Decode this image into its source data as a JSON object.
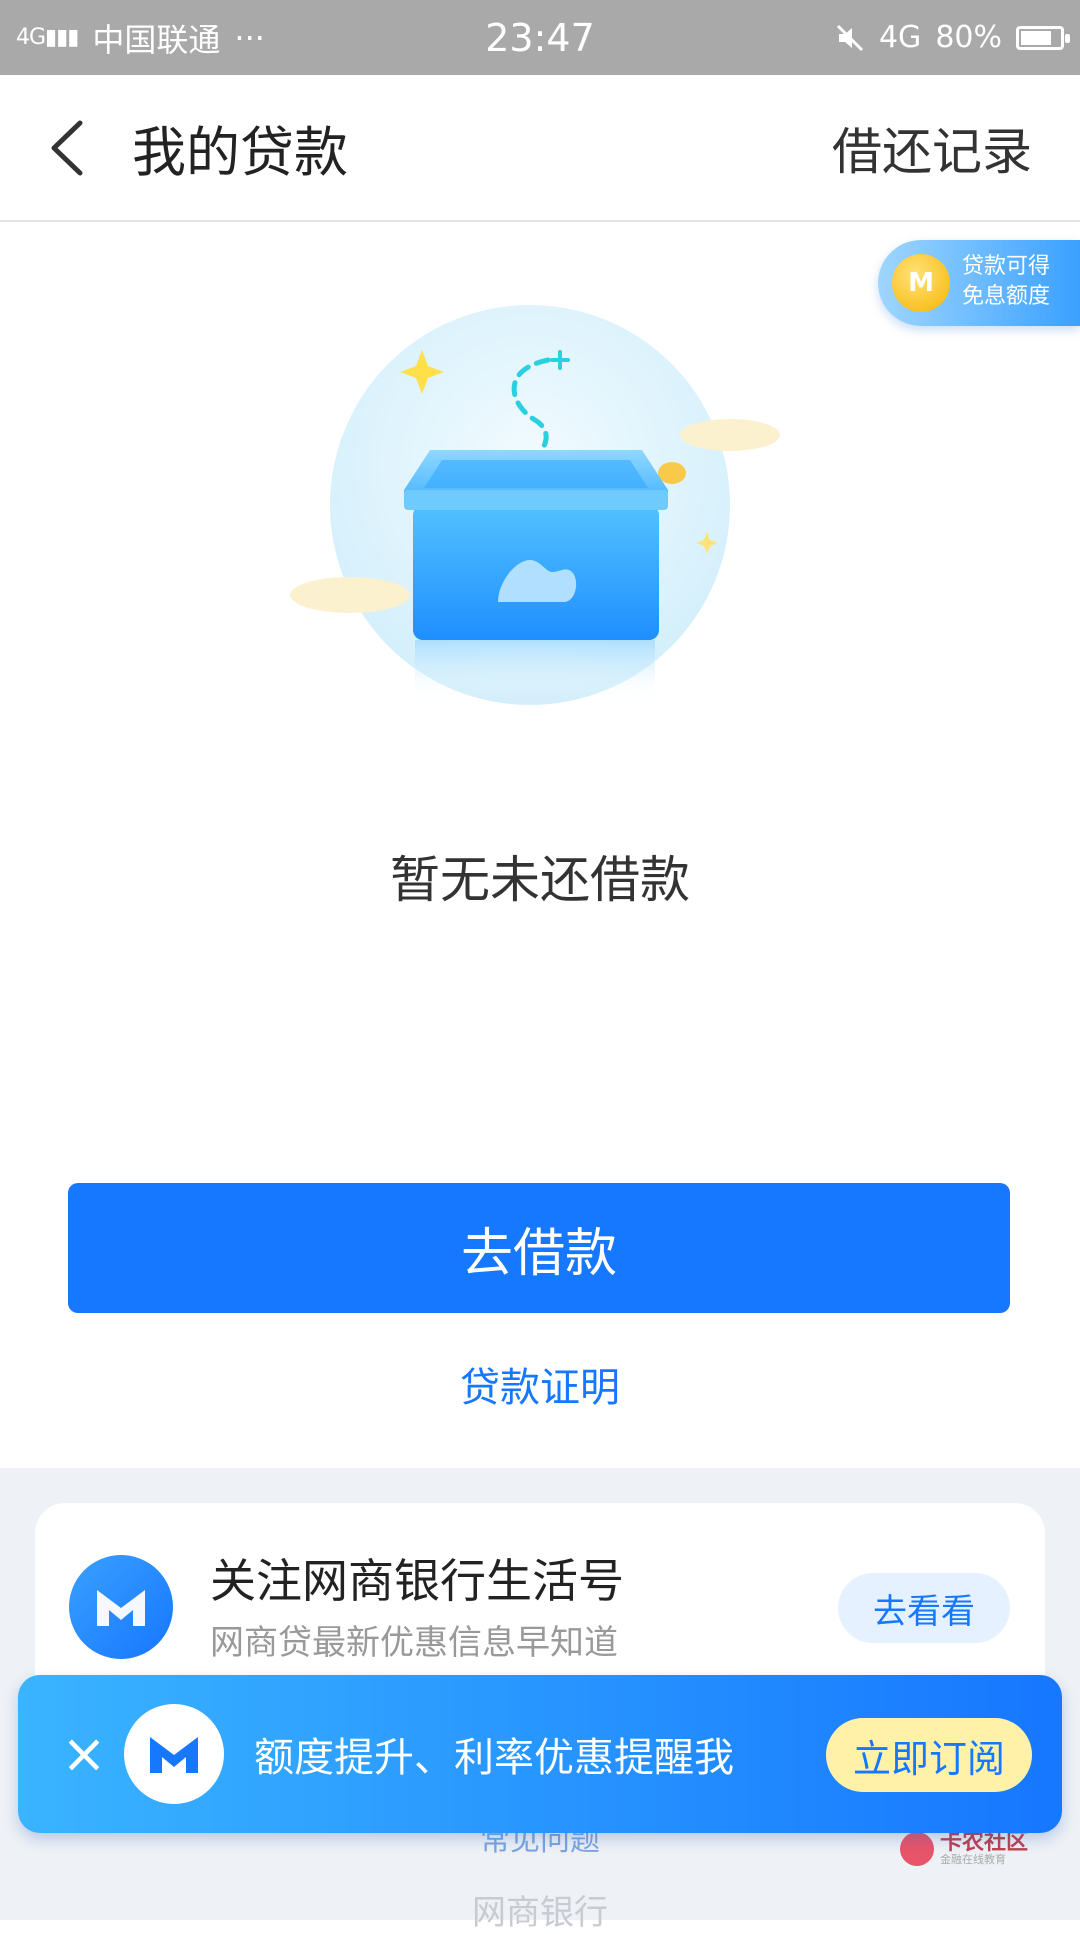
{
  "status_bar": {
    "network_type": "4G",
    "carrier": "中国联通",
    "more": "···",
    "time": "23:47",
    "network": "4G",
    "battery": "80%",
    "battery_level": 0.8
  },
  "navbar": {
    "title": "我的贷款",
    "right_link": "借还记录"
  },
  "promo_chip": {
    "coin_letter": "M",
    "line1": "贷款可得",
    "line2": "免息额度"
  },
  "main": {
    "empty_text": "暂无未还借款",
    "borrow_button": "去借款",
    "proof_link": "贷款证明"
  },
  "card": {
    "title": "关注网商银行生活号",
    "subtitle": "网商贷最新优惠信息早知道",
    "button": "去看看"
  },
  "banner": {
    "close": "×",
    "text": "额度提升、利率优惠提醒我",
    "button": "立即订阅"
  },
  "footer": {
    "faq": "常见问题",
    "brand": "网商银行"
  },
  "watermark": {
    "name": "卡农社区",
    "tagline": "金融在线教育"
  },
  "colors": {
    "accent": "#1677ff",
    "status_bar": "#a9a9a9",
    "subscribe_button": "#fff2a8"
  }
}
